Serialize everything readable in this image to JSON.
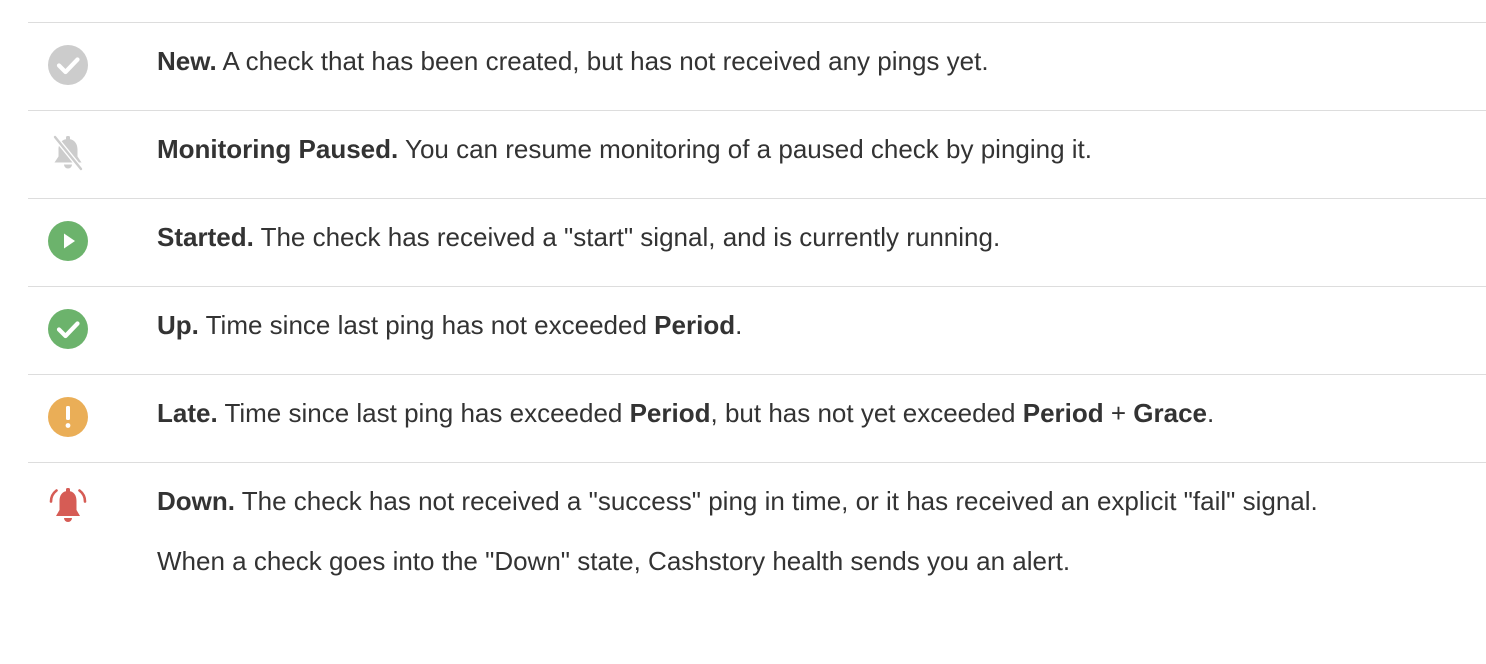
{
  "colors": {
    "new": "#cccccc",
    "paused": "#cccccc",
    "started": "#6cb36c",
    "up": "#6cb36c",
    "late": "#eaae57",
    "down": "#d65c55",
    "border": "#dddddd",
    "text": "#333333"
  },
  "statuses": [
    {
      "icon": "check-circle-icon",
      "name": "New.",
      "text": " A check that has been created, but has not received any pings yet."
    },
    {
      "icon": "bell-slash-icon",
      "name": "Monitoring Paused.",
      "text": " You can resume monitoring of a paused check by pinging it."
    },
    {
      "icon": "play-circle-icon",
      "name": "Started.",
      "text": " The check has received a \"start\" signal, and is currently running."
    },
    {
      "icon": "check-circle-icon",
      "name": "Up.",
      "text": " Time since last ping has not exceeded ",
      "bold1": "Period",
      "tail": "."
    },
    {
      "icon": "exclamation-circle-icon",
      "name": "Late.",
      "text": " Time since last ping has exceeded ",
      "bold1": "Period",
      "mid": ", but has not yet exceeded ",
      "bold2": "Period",
      "plus": " + ",
      "bold3": "Grace",
      "tail": "."
    },
    {
      "icon": "bell-ringing-icon",
      "name": "Down.",
      "text": " The check has not received a \"success\" ping in time, or it has received an explicit \"fail\" signal.",
      "note": "When a check goes into the \"Down\" state, Cashstory health sends you an alert."
    }
  ]
}
